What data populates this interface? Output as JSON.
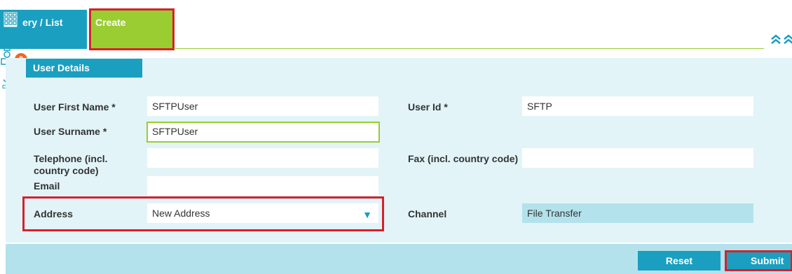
{
  "tabs": [
    {
      "label": "ery / List"
    },
    {
      "label": "Create"
    }
  ],
  "collapse_icon": "double-chevron-up",
  "badges": {
    "orange": "0",
    "green": "0"
  },
  "section": {
    "title": "User Details"
  },
  "fields": {
    "first_name": {
      "label": "User First Name *",
      "value": "SFTPUser"
    },
    "surname": {
      "label": "User Surname *",
      "value": "SFTPUser"
    },
    "telephone": {
      "label": "Telephone (incl. country code)",
      "value": ""
    },
    "email": {
      "label": "Email",
      "value": ""
    },
    "address": {
      "label": "Address",
      "value": "New Address"
    },
    "user_id": {
      "label": "User Id *",
      "value": "SFTP"
    },
    "fax": {
      "label": "Fax (incl. country code)",
      "value": ""
    },
    "channel": {
      "label": "Channel",
      "value": "File Transfer"
    }
  },
  "buttons": {
    "reset": "Reset",
    "submit": "Submit"
  },
  "colors": {
    "primary": "#1a9fc0",
    "accent": "#9acd32",
    "highlight": "#d8202a",
    "panel": "#e2f4f8"
  }
}
